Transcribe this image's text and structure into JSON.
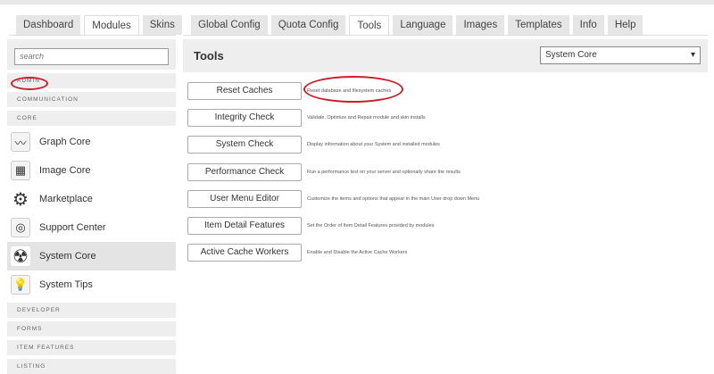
{
  "left_tabs": [
    "Dashboard",
    "Modules",
    "Skins"
  ],
  "left_active": 1,
  "right_tabs": [
    "Global Config",
    "Quota Config",
    "Tools",
    "Language",
    "Images",
    "Templates",
    "Info",
    "Help"
  ],
  "right_active": 2,
  "search": {
    "placeholder": "search"
  },
  "categories_top": [
    "ADMIN",
    "COMMUNICATION",
    "CORE"
  ],
  "modules": [
    {
      "label": "Graph Core",
      "icon": "graph-icon"
    },
    {
      "label": "Image Core",
      "icon": "image-icon"
    },
    {
      "label": "Marketplace",
      "icon": "gear-icon"
    },
    {
      "label": "Support Center",
      "icon": "lifebuoy-icon"
    },
    {
      "label": "System Core",
      "icon": "radiation-icon",
      "selected": true
    },
    {
      "label": "System Tips",
      "icon": "lightbulb-icon"
    }
  ],
  "categories_bottom": [
    "DEVELOPER",
    "FORMS",
    "ITEM FEATURES",
    "LISTING"
  ],
  "main": {
    "title": "Tools",
    "select_value": "System Core",
    "tools": [
      {
        "label": "Reset Caches",
        "desc": "Reset database and filesystem caches"
      },
      {
        "label": "Integrity Check",
        "desc": "Validate, Optimize and Repair module and skin installs"
      },
      {
        "label": "System Check",
        "desc": "Display information about your System and installed modules"
      },
      {
        "label": "Performance Check",
        "desc": "Run a performance test on your server and optionally share the results"
      },
      {
        "label": "User Menu Editor",
        "desc": "Customize the items and options that appear in the main User drop down Menu"
      },
      {
        "label": "Item Detail Features",
        "desc": "Set the Order of Item Detail Features provided by modules"
      },
      {
        "label": "Active Cache Workers",
        "desc": "Enable and Disable the Active Cache Workers"
      }
    ]
  },
  "colors": {
    "annotation": "#c8202a"
  }
}
